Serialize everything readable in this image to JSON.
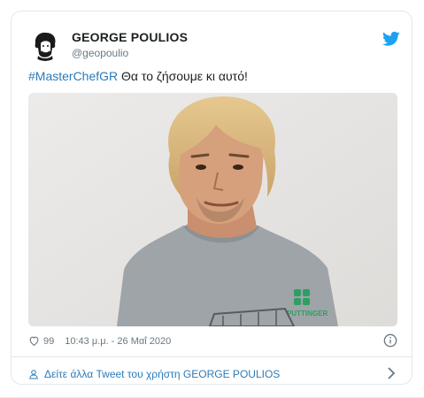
{
  "tweet": {
    "author_name": "GEORGE POULIOS",
    "author_handle": "@geopoulio",
    "hashtag": "#MasterChefGR",
    "text": " Θα το ζήσουμε κι αυτό!",
    "likes": "99",
    "timestamp": "10:43 μ.μ. - 26 Μαΐ 2020",
    "shirt_brand": "PUTTINGER",
    "more_link": "Δείτε άλλα Tweet του χρήστη GEORGE POULIOS"
  },
  "icons": {
    "brand": "twitter-bird-icon",
    "like": "heart-icon",
    "info": "info-icon",
    "profile": "person-icon",
    "chevron": "chevron-right-icon"
  },
  "colors": {
    "link": "#2b7bb9",
    "twitter_blue": "#1da1f2",
    "muted": "#697882",
    "border": "#e1e8ed"
  }
}
